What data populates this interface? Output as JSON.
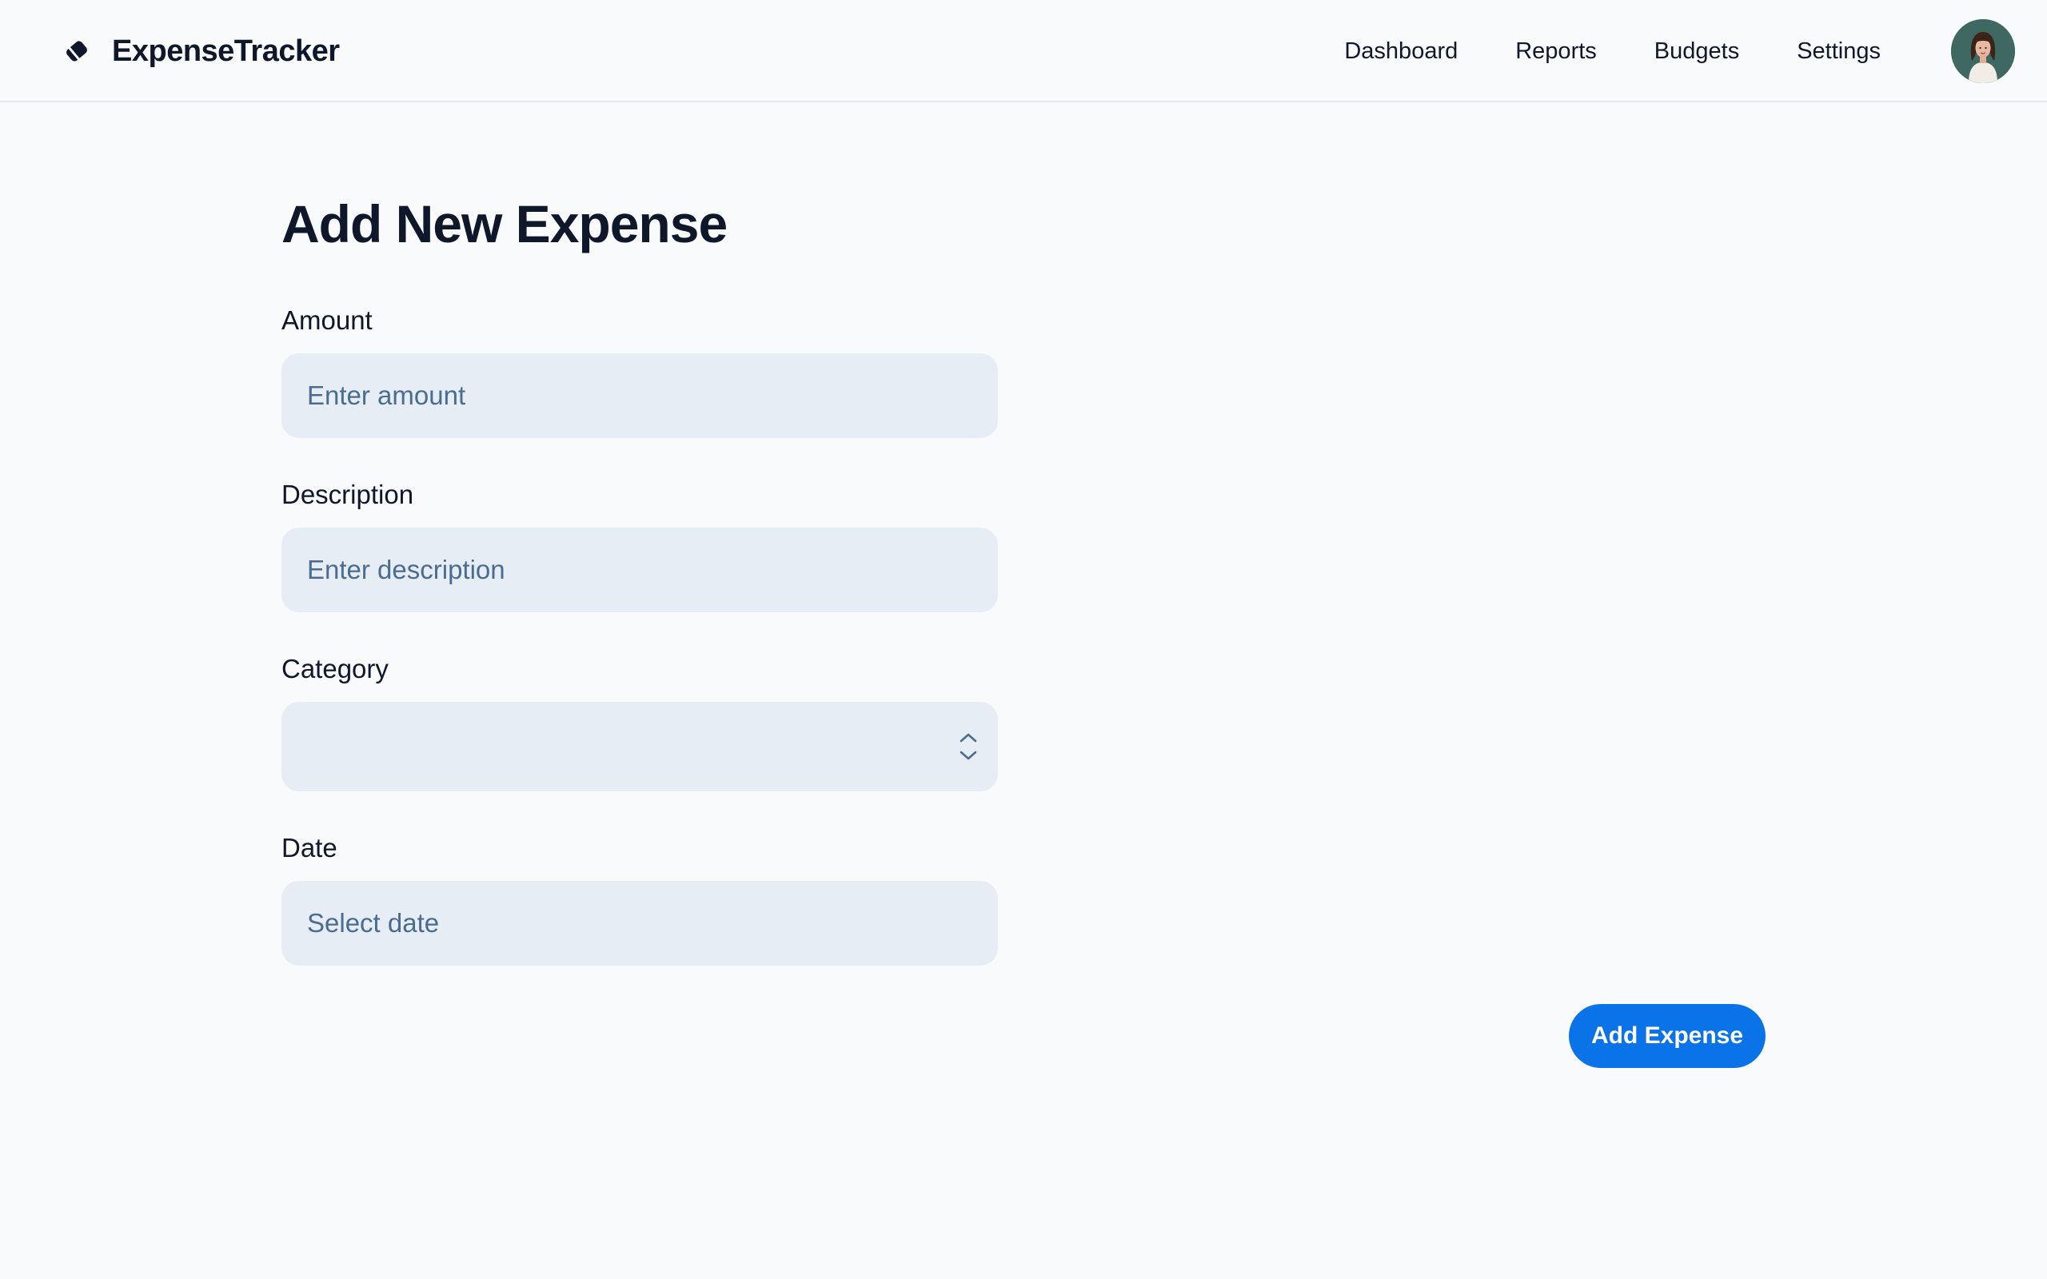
{
  "app": {
    "name": "ExpenseTracker",
    "logo_icon": "tag-icon"
  },
  "nav": {
    "items": [
      {
        "label": "Dashboard"
      },
      {
        "label": "Reports"
      },
      {
        "label": "Budgets"
      },
      {
        "label": "Settings"
      }
    ],
    "avatar_icon": "user-avatar"
  },
  "form": {
    "title": "Add New Expense",
    "amount": {
      "label": "Amount",
      "placeholder": "Enter amount",
      "value": ""
    },
    "description": {
      "label": "Description",
      "placeholder": "Enter description",
      "value": ""
    },
    "category": {
      "label": "Category",
      "selected": "",
      "icon": "chevron-up-down-icon"
    },
    "date": {
      "label": "Date",
      "placeholder": "Select date",
      "value": ""
    },
    "submit_label": "Add Expense"
  },
  "colors": {
    "accent": "#0b73e8",
    "input_bg": "#e7edf5",
    "placeholder": "#4a6c91",
    "page_bg": "#f8fafc",
    "text": "#0f172a"
  }
}
